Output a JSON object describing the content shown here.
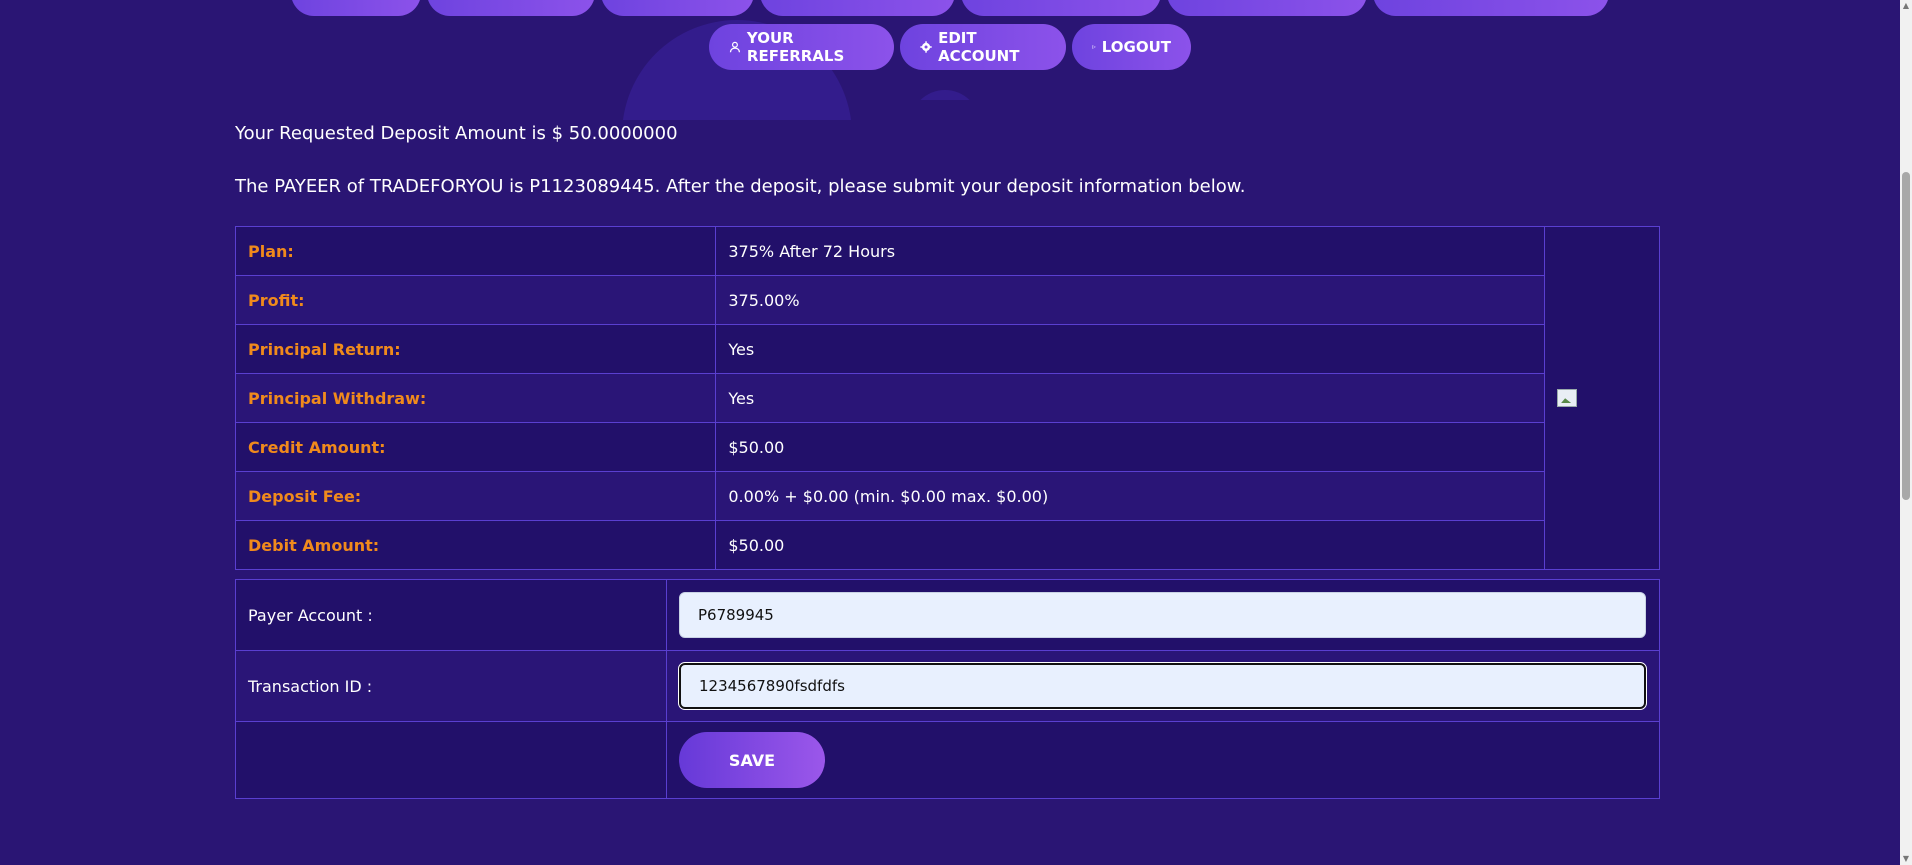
{
  "nav": {
    "top_row": [
      "",
      "",
      "",
      "",
      "",
      "",
      ""
    ],
    "bottom_row": [
      {
        "label": "YOUR REFERRALS",
        "icon": "user-icon"
      },
      {
        "label": "EDIT ACCOUNT",
        "icon": "gear-icon"
      },
      {
        "label": "LOGOUT",
        "icon": "logout-icon"
      }
    ]
  },
  "deposit": {
    "requested_line": "Your Requested Deposit Amount is $ 50.0000000",
    "payeer_line": "The PAYEER of TRADEFORYOU is P1123089445. After the deposit, please submit your deposit information below."
  },
  "details": [
    {
      "label": "Plan:",
      "value": "375% After 72 Hours"
    },
    {
      "label": "Profit:",
      "value": "375.00%"
    },
    {
      "label": "Principal Return:",
      "value": "Yes"
    },
    {
      "label": "Principal Withdraw:",
      "value": "Yes"
    },
    {
      "label": "Credit Amount:",
      "value": "$50.00"
    },
    {
      "label": "Deposit Fee:",
      "value": "0.00% + $0.00 (min. $0.00 max. $0.00)"
    },
    {
      "label": "Debit Amount:",
      "value": "$50.00"
    }
  ],
  "form": {
    "payer_account_label": "Payer Account :",
    "payer_account_value": "P6789945",
    "transaction_id_label": "Transaction ID :",
    "transaction_id_value": "1234567890fsdfdfs",
    "save_label": "SAVE"
  },
  "colors": {
    "background": "#2a1574",
    "label_orange": "#f08a1c",
    "button_gradient_start": "#6639d8",
    "button_gradient_end": "#9b57ea"
  }
}
